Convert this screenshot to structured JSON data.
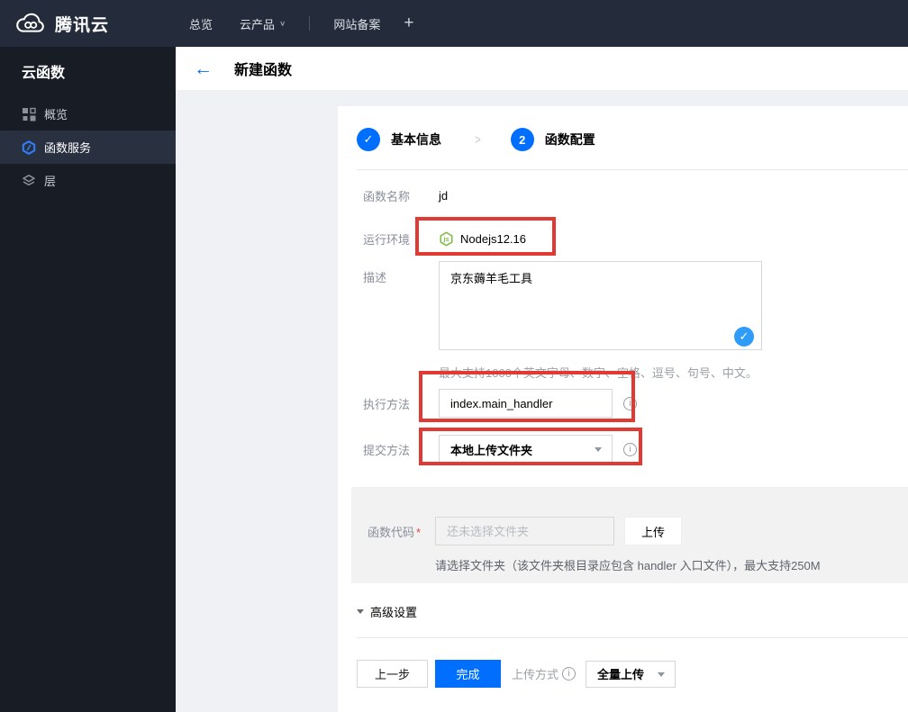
{
  "topbar": {
    "brand": "腾讯云",
    "nav": [
      {
        "label": "总览"
      },
      {
        "label": "云产品"
      },
      {
        "label": "网站备案"
      }
    ]
  },
  "sidebar": {
    "title": "云函数",
    "items": [
      {
        "label": "概览",
        "icon": "grid-icon",
        "active": false
      },
      {
        "label": "函数服务",
        "icon": "scf-hexagon-icon",
        "active": true
      },
      {
        "label": "层",
        "icon": "layers-icon",
        "active": false
      }
    ]
  },
  "header": {
    "title": "新建函数"
  },
  "steps": {
    "step1_label": "基本信息",
    "step2_number": "2",
    "step2_label": "函数配置"
  },
  "form": {
    "name_label": "函数名称",
    "name_value": "jd",
    "runtime_label": "运行环境",
    "runtime_value": "Nodejs12.16",
    "desc_label": "描述",
    "desc_value": "京东薅羊毛工具",
    "desc_hint": "最大支持1000个英文字母、数字、空格、逗号、句号、中文。",
    "handler_label": "执行方法",
    "handler_value": "index.main_handler",
    "submit_label": "提交方法",
    "submit_value": "本地上传文件夹",
    "code_label": "函数代码",
    "required_mark": "*",
    "code_placeholder": "还未选择文件夹",
    "upload_button": "上传",
    "code_hint": "请选择文件夹（该文件夹根目录应包含 handler 入口文件），最大支持250M",
    "advanced_label": "高级设置"
  },
  "footer": {
    "prev": "上一步",
    "finish": "完成",
    "upload_mode_label": "上传方式",
    "upload_mode_value": "全量上传"
  },
  "icons": {
    "back_arrow": "←",
    "check": "✓",
    "chevron_right": ">",
    "caret_down": "∨",
    "plus": "+",
    "info": "i"
  },
  "colors": {
    "primary_blue": "#006eff",
    "annotation_red": "#e23a32",
    "nodejs_green": "#7fbd42",
    "confirm_check_blue": "#2e9cf8",
    "topbar_bg": "#242c3b",
    "sidebar_bg": "#171c25"
  }
}
